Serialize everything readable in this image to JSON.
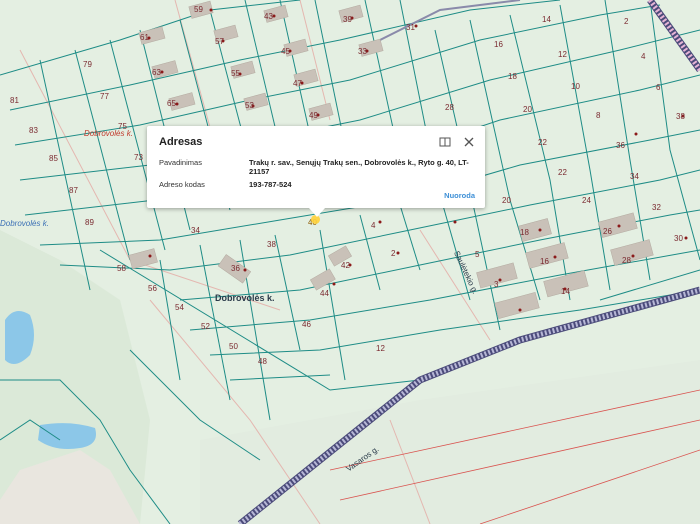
{
  "popup": {
    "title": "Adresas",
    "rows": [
      {
        "key": "Pavadinimas",
        "value": "Trakų r. sav., Senųjų Trakų sen., Dobrovolės k., Ryto g. 40, LT-21157"
      },
      {
        "key": "Adreso kodas",
        "value": "193-787-524"
      }
    ],
    "link": "Nuoroda",
    "icons": [
      "maximize-icon",
      "close-icon"
    ]
  },
  "streets": {
    "dobrovoles_italic_1": "Dobrovolės k.",
    "dobrovoles_italic_2": "Dobrovolės k.",
    "dobrovoles_main": "Dobrovolės k.",
    "saules": "Saulėtekio g.",
    "vasaros": "Vasaros g."
  },
  "parcels": [
    "59",
    "43",
    "39",
    "31",
    "14",
    "2",
    "61",
    "57",
    "45",
    "33",
    "16",
    "12",
    "4",
    "79",
    "63",
    "55",
    "47",
    "18",
    "10",
    "6",
    "81",
    "77",
    "65",
    "53",
    "49",
    "28",
    "20",
    "8",
    "38",
    "83",
    "75",
    "85",
    "73",
    "34",
    "22",
    "36",
    "87",
    "22",
    "34",
    "24",
    "32",
    "89",
    "34",
    "38",
    "4",
    "20",
    "18",
    "26",
    "30",
    "58",
    "36",
    "42",
    "2",
    "5",
    "16",
    "28",
    "56",
    "44",
    "3",
    "54",
    "46",
    "14",
    "52",
    "50",
    "12",
    "48",
    "40"
  ],
  "colors": {
    "parcel_border": "#1e8c86",
    "land": "#e4efe2",
    "water": "#8cc7e8",
    "building": "#c9c1b8",
    "railway": "#6a6a98",
    "label": "#7a2a30"
  }
}
